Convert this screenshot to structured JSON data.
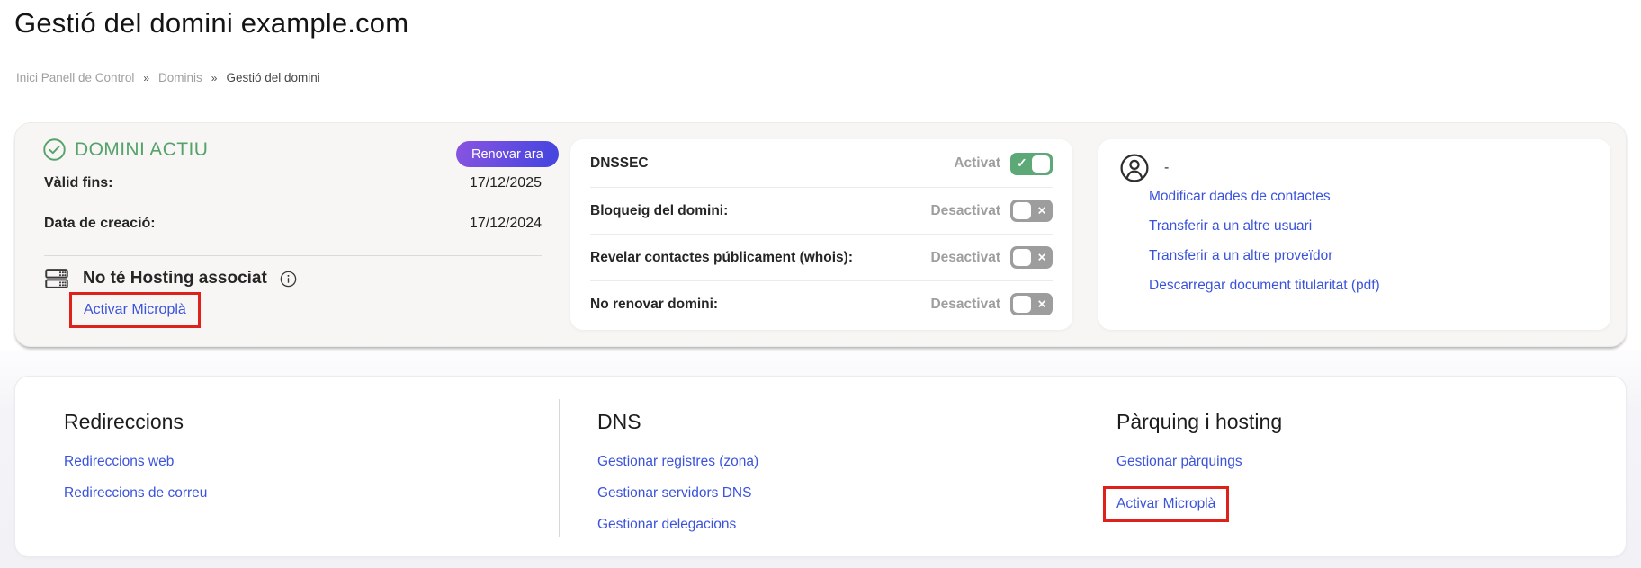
{
  "page": {
    "title": "Gestió del domini example.com",
    "breadcrumb": {
      "separator": "»",
      "items": [
        {
          "label": "Inici Panell de Control"
        },
        {
          "label": "Dominis"
        },
        {
          "label": "Gestió del domini"
        }
      ]
    }
  },
  "status_card": {
    "status_label": "DOMINI ACTIU",
    "renew_button_label": "Renovar ara",
    "fields": [
      {
        "label": "Vàlid fins:",
        "value": "17/12/2025"
      },
      {
        "label": "Data de creació:",
        "value": "17/12/2024"
      }
    ],
    "hosting_text": "No té Hosting associat",
    "hosting_link_label": "Activar Microplà"
  },
  "dnssec_card": {
    "rows": [
      {
        "label": "DNSSEC",
        "state": "Activat",
        "enabled": true
      },
      {
        "label": "Bloqueig del domini:",
        "state": "Desactivat",
        "enabled": false
      },
      {
        "label": "Revelar contactes públicament (whois):",
        "state": "Desactivat",
        "enabled": false
      },
      {
        "label": "No renovar domini:",
        "state": "Desactivat",
        "enabled": false
      }
    ]
  },
  "contact_card": {
    "owner_label": "-",
    "links": [
      {
        "label": "Modificar dades de contactes"
      },
      {
        "label": "Transferir a un altre usuari"
      },
      {
        "label": "Transferir a un altre proveïdor"
      },
      {
        "label": "Descarregar document titularitat (pdf)"
      }
    ]
  },
  "management_sections": [
    {
      "title": "Redireccions",
      "links": [
        {
          "label": "Redireccions web"
        },
        {
          "label": "Redireccions de correu"
        }
      ]
    },
    {
      "title": "DNS",
      "links": [
        {
          "label": "Gestionar registres (zona)"
        },
        {
          "label": "Gestionar servidors DNS"
        },
        {
          "label": "Gestionar delegacions"
        }
      ]
    },
    {
      "title": "Pàrquing i hosting",
      "links": [
        {
          "label": "Gestionar pàrquings"
        },
        {
          "label": "Activar Microplà",
          "highlighted": true
        }
      ]
    }
  ],
  "icons": {
    "toggle_check": "✓",
    "toggle_x": "✕"
  },
  "colors": {
    "status_green": "#55a36b",
    "toggle_on_green": "#5ca877",
    "toggle_off_gray": "#9d9d9d",
    "link_blue": "#3b53dc",
    "highlight_red": "#de211b",
    "renew_gradient_start": "#8a54e1",
    "renew_gradient_end": "#4846df",
    "state_text_gray": "#9e9e9e",
    "card1_background": "#f7f6f4"
  }
}
